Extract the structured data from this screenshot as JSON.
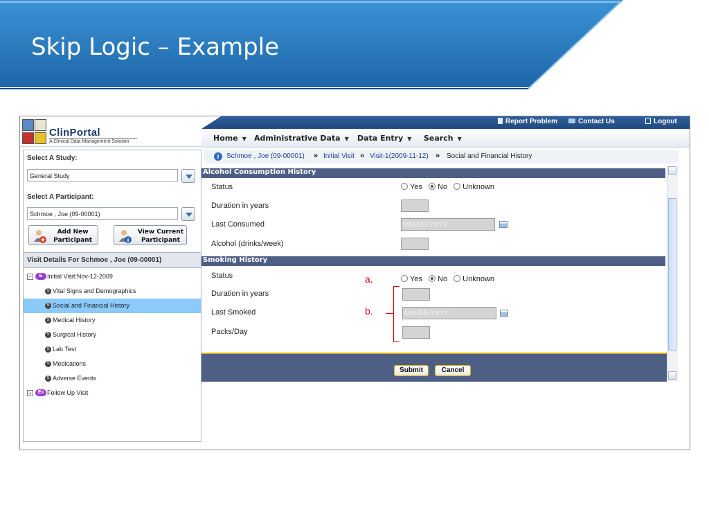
{
  "slide": {
    "title": "Skip Logic – Example"
  },
  "app": {
    "logo": {
      "name": "ClinPortal",
      "tagline": "A Clinical Data Management Solution"
    },
    "topbar": {
      "report_problem": "Report Problem",
      "contact_us": "Contact Us",
      "logout": "Logout"
    },
    "menu": [
      {
        "label": "Home"
      },
      {
        "label": "Administrative Data"
      },
      {
        "label": "Data Entry"
      },
      {
        "label": "Search"
      }
    ],
    "sidebar": {
      "study_label": "Select A Study:",
      "study_value": "General Study",
      "participant_label": "Select A Participant:",
      "participant_value": "Schmoe , Joe (09-00001)",
      "add_new_line1": "Add New",
      "add_new_line2": "Participant",
      "view_current_line1": "View Current",
      "view_current_line2": "Participant",
      "visit_details": "Visit Details For  Schmoe , Joe (09-00001)",
      "tree": {
        "initial_visit": "Initial Visit:Nov-12-2009",
        "initial_badge": "E",
        "forms": [
          "Vital Signs and Demographics",
          "Social and Financial History",
          "Medical History",
          "Surgical History",
          "Lab Test",
          "Medications",
          "Adverse Events"
        ],
        "form_badge": "S",
        "follow_up": "Follow Up Visit",
        "follow_badge": "Ex"
      }
    },
    "breadcrumb": {
      "participant": "Schmoe , Joe (09-00001)",
      "visit": "Initial Visit",
      "visit_instance": "Visit-1(2009-11-12)",
      "current": "Social and Financial History",
      "separator": "»"
    },
    "alcohol": {
      "title": "Alcohol Consumption History",
      "status_label": "Status",
      "duration_label": "Duration in years",
      "last_consumed_label": "Last Consumed",
      "date_placeholder": "MM-DD-YYYY",
      "drinks_label": "Alcohol (drinks/week)",
      "status_selected": "No"
    },
    "smoking": {
      "title": "Smoking History",
      "status_label": "Status",
      "duration_label": "Duration in years",
      "last_smoked_label": "Last Smoked",
      "date_placeholder": "MM-DD-YYYY",
      "packs_label": "Packs/Day",
      "status_selected": "No"
    },
    "radio_options": [
      "Yes",
      "No",
      "Unknown"
    ],
    "annotations": {
      "a": "a.",
      "b": "b."
    },
    "buttons": {
      "submit": "Submit",
      "cancel": "Cancel"
    }
  },
  "colors": {
    "banner_blue": "#2d7fc4",
    "section_header": "#4e5f86",
    "selected_row": "#8ccafc",
    "annotation": "#e00000",
    "button_border": "#d8b400"
  }
}
